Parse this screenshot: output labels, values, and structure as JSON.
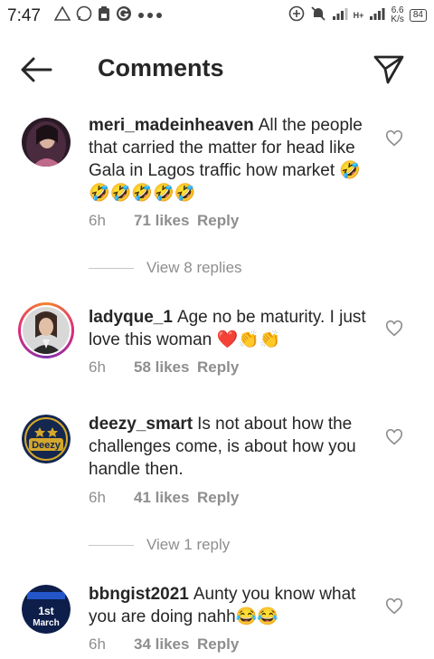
{
  "status_bar": {
    "time": "7:47",
    "network_type": "H+",
    "speed_value": "6.6",
    "speed_unit": "K/s",
    "battery": "84"
  },
  "header": {
    "title": "Comments"
  },
  "comments": [
    {
      "username": "meri_madeinheaven",
      "text": "All the people that carried the matter for head like Gala in  Lagos traffic how market 🤣🤣🤣🤣🤣🤣",
      "time": "6h",
      "likes": "71 likes",
      "reply_label": "Reply",
      "view_replies": "View 8 replies"
    },
    {
      "username": "ladyque_1",
      "text": "Age no be maturity. I just love this woman ❤️👏👏",
      "time": "6h",
      "likes": "58 likes",
      "reply_label": "Reply"
    },
    {
      "username": "deezy_smart",
      "text": "Is not about how the challenges come, is about how you handle then.",
      "time": "6h",
      "likes": "41 likes",
      "reply_label": "Reply",
      "view_replies": "View 1 reply",
      "avatar_text": "Deezy"
    },
    {
      "username": "bbngist2021",
      "text": "Aunty you know what you are doing nahh😂😂",
      "time": "6h",
      "likes": "34 likes",
      "reply_label": "Reply",
      "avatar_text_top": "1st",
      "avatar_text_bottom": "March"
    }
  ]
}
